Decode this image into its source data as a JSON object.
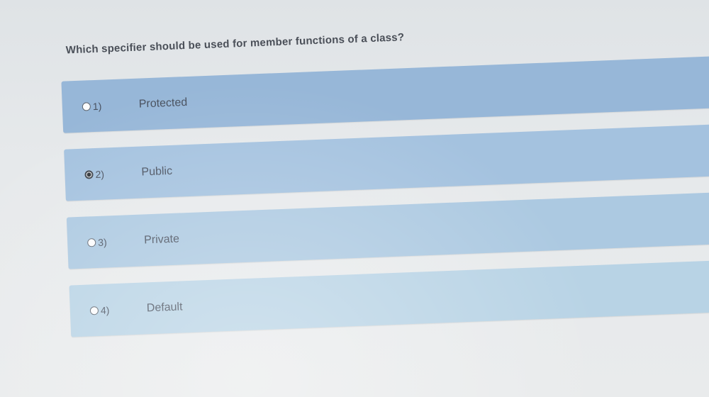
{
  "question": "Which specifier should be used for member functions of a class?",
  "options": [
    {
      "number": "1)",
      "label": "Protected",
      "selected": false
    },
    {
      "number": "2)",
      "label": "Public",
      "selected": true
    },
    {
      "number": "3)",
      "label": "Private",
      "selected": false
    },
    {
      "number": "4)",
      "label": "Default",
      "selected": false
    }
  ]
}
